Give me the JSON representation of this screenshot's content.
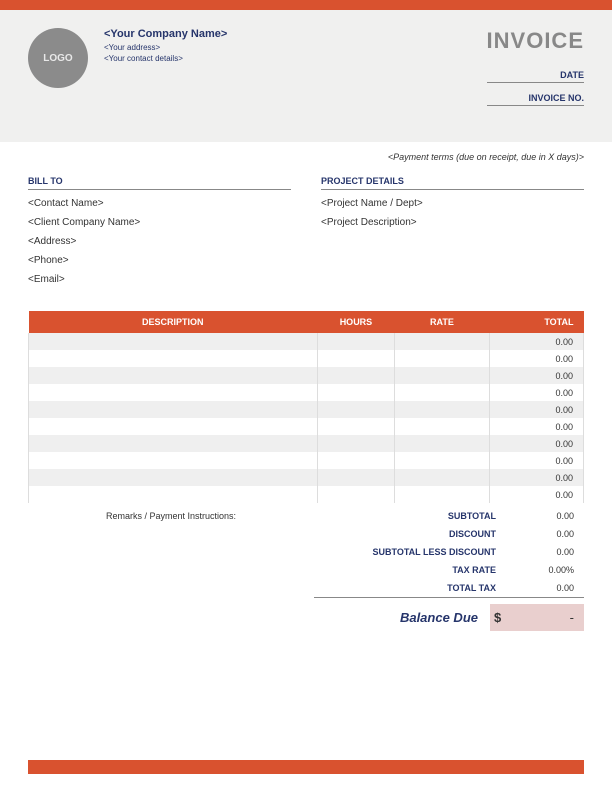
{
  "header": {
    "logo_text": "LOGO",
    "company_name": "<Your Company Name>",
    "address": "<Your address>",
    "contact": "<Your contact details>",
    "invoice_title": "INVOICE",
    "date_label": "DATE",
    "invoice_no_label": "INVOICE NO."
  },
  "payment_terms": "<Payment terms (due on receipt, due in X days)>",
  "bill_to": {
    "label": "BILL TO",
    "contact_name": "<Contact Name>",
    "client_company": "<Client Company Name>",
    "address": "<Address>",
    "phone": "<Phone>",
    "email": "<Email>"
  },
  "project": {
    "label": "PROJECT DETAILS",
    "name": "<Project Name / Dept>",
    "description": "<Project Description>"
  },
  "table": {
    "headers": {
      "description": "DESCRIPTION",
      "hours": "HOURS",
      "rate": "RATE",
      "total": "TOTAL"
    },
    "rows": [
      {
        "desc": "",
        "hours": "",
        "rate": "",
        "total": "0.00"
      },
      {
        "desc": "",
        "hours": "",
        "rate": "",
        "total": "0.00"
      },
      {
        "desc": "",
        "hours": "",
        "rate": "",
        "total": "0.00"
      },
      {
        "desc": "",
        "hours": "",
        "rate": "",
        "total": "0.00"
      },
      {
        "desc": "",
        "hours": "",
        "rate": "",
        "total": "0.00"
      },
      {
        "desc": "",
        "hours": "",
        "rate": "",
        "total": "0.00"
      },
      {
        "desc": "",
        "hours": "",
        "rate": "",
        "total": "0.00"
      },
      {
        "desc": "",
        "hours": "",
        "rate": "",
        "total": "0.00"
      },
      {
        "desc": "",
        "hours": "",
        "rate": "",
        "total": "0.00"
      },
      {
        "desc": "",
        "hours": "",
        "rate": "",
        "total": "0.00"
      }
    ]
  },
  "remarks_label": "Remarks / Payment Instructions:",
  "totals": {
    "subtotal_label": "SUBTOTAL",
    "subtotal_val": "0.00",
    "discount_label": "DISCOUNT",
    "discount_val": "0.00",
    "less_discount_label": "SUBTOTAL LESS DISCOUNT",
    "less_discount_val": "0.00",
    "tax_rate_label": "TAX RATE",
    "tax_rate_val": "0.00%",
    "total_tax_label": "TOTAL TAX",
    "total_tax_val": "0.00",
    "balance_label": "Balance Due",
    "balance_currency": "$",
    "balance_val": "-"
  }
}
